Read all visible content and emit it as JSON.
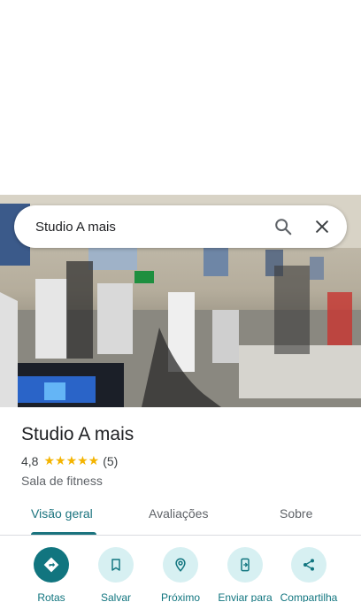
{
  "search": {
    "query": "Studio A mais"
  },
  "place": {
    "name": "Studio A mais",
    "rating": "4,8",
    "stars": "★★★★★",
    "review_count": "(5)",
    "category": "Sala de fitness"
  },
  "tabs": [
    {
      "label": "Visão geral",
      "active": true
    },
    {
      "label": "Avaliações",
      "active": false
    },
    {
      "label": "Sobre",
      "active": false
    }
  ],
  "actions": [
    {
      "label": "Rotas",
      "icon": "directions-icon"
    },
    {
      "label": "Salvar",
      "icon": "bookmark-icon"
    },
    {
      "label": "Próximo",
      "icon": "nearby-icon"
    },
    {
      "label": "Enviar para",
      "icon": "send-to-phone-icon"
    },
    {
      "label": "Compartilha",
      "icon": "share-icon"
    }
  ],
  "colors": {
    "accent": "#1a737e",
    "action_bg": "#d7f0f2",
    "star": "#f4b400"
  }
}
